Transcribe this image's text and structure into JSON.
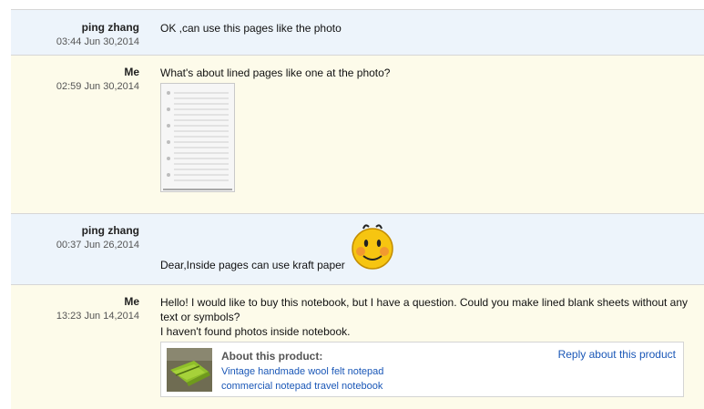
{
  "messages": [
    {
      "sender": "ping zhang",
      "time": "03:44 Jun 30,2014",
      "text": "OK ,can use this pages like the photo"
    },
    {
      "sender": "Me",
      "time": "02:59 Jun 30,2014",
      "text": "What's about lined pages like one at the photo?"
    },
    {
      "sender": "ping zhang",
      "time": "00:37 Jun 26,2014",
      "text": "Dear,Inside pages can use kraft paper"
    },
    {
      "sender": "Me",
      "time": "13:23 Jun 14,2014",
      "lines": [
        "Hello! I would like to buy this notebook, but I have a question. Could you make lined blank sheets without any text or symbols?",
        "I haven't found photos inside notebook."
      ]
    }
  ],
  "product": {
    "title": "About this product:",
    "link1": "Vintage handmade wool felt notepad",
    "link2": "commercial notepad travel notebook",
    "reply": "Reply about this product"
  },
  "colors": {
    "them_bg": "#edf4fb",
    "me_bg": "#fdfbea",
    "link": "#1a57b7"
  },
  "icons": [
    "lined-paper-photo",
    "smiley-face-icon",
    "felt-notebook-photo"
  ]
}
